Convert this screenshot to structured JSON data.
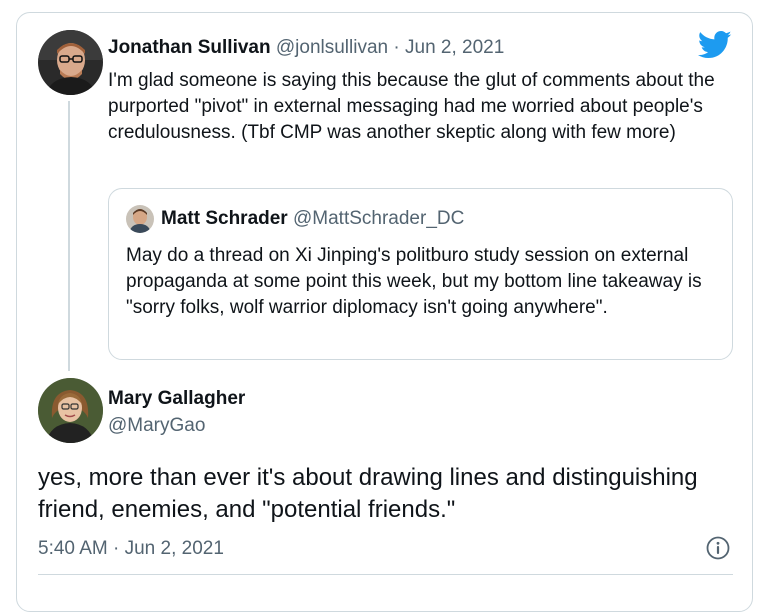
{
  "tweet1": {
    "name": "Jonathan Sullivan",
    "handle": "@jonlsullivan",
    "separator": "·",
    "date": "Jun 2, 2021",
    "text": "I'm glad someone is saying this because the glut of comments about the purported \"pivot\" in external messaging had me worried about people's credulousness. (Tbf CMP was another skeptic along with few more)",
    "avatar_icon": "profile-photo"
  },
  "quoted": {
    "name": "Matt Schrader",
    "handle": "@MattSchrader_DC",
    "text": "May do a thread on Xi Jinping's politburo study session on external propaganda at some point this week, but my bottom line takeaway is \"sorry folks, wolf warrior diplomacy isn't going anywhere\"."
  },
  "tweet2": {
    "name": "Mary Gallagher",
    "handle": "@MaryGao",
    "text": "yes, more than ever it's about drawing lines and distinguishing friend, enemies, and \"potential friends.\"",
    "timestamp": "5:40 AM · Jun 2, 2021"
  },
  "icons": {
    "brand": "twitter-bird-icon",
    "info": "info-icon"
  },
  "colors": {
    "twitter_blue": "#1d9bf0",
    "muted_text": "#536471",
    "border": "#cfd9de"
  }
}
